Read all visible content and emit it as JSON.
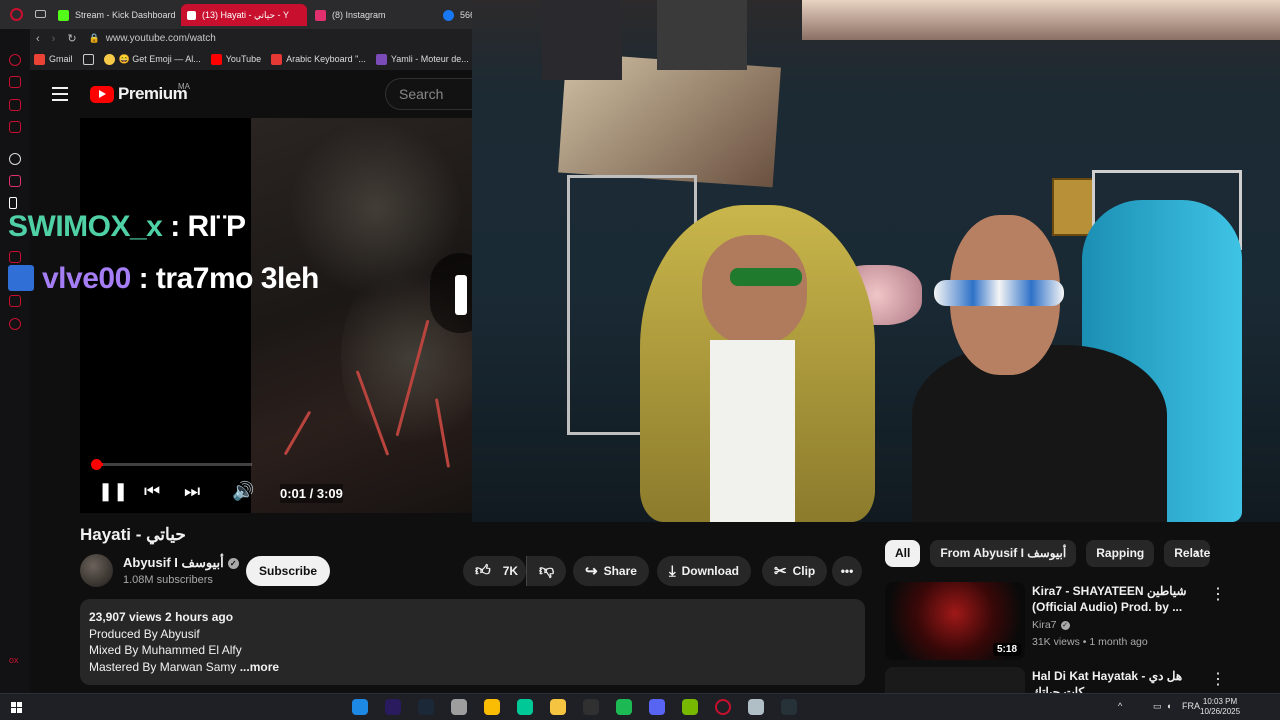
{
  "browser": {
    "tabs": [
      {
        "label": "Stream - Kick Dashboard",
        "color": "#53fc18",
        "active": false
      },
      {
        "label": "(13) Hayati - حياتي - Y",
        "color": "#ff0000",
        "active": true
      },
      {
        "label": "(8) Instagram",
        "color": "#e1306c",
        "active": false
      },
      {
        "label": "566",
        "color": "#1877f2",
        "active": false
      }
    ],
    "url": "www.youtube.com/watch",
    "bookmarks": [
      {
        "label": "Gmail",
        "color": "#ea4335"
      },
      {
        "label": "",
        "color": "#cccccc"
      },
      {
        "label": "😄 Get Emoji — Al...",
        "color": "#f7c948"
      },
      {
        "label": "YouTube",
        "color": "#ff0000"
      },
      {
        "label": "Arabic Keyboard \"...",
        "color": "#e53935"
      },
      {
        "label": "Yamli - Moteur de...",
        "color": "#7b4bb7"
      }
    ]
  },
  "header": {
    "logo_text": "Premium",
    "region": "MA",
    "search_placeholder": "Search"
  },
  "player": {
    "chat": [
      {
        "user": "SWIMOX_x",
        "message": " : RI¨P"
      },
      {
        "user": "vlve00",
        "message": " : tra7mo 3leh"
      }
    ],
    "time_current": "0:01",
    "time_total": "3:09",
    "time_display": "0:01 / 3:09",
    "progress_fraction": 0.005
  },
  "video": {
    "title": "Hayati - حياتي",
    "channel": "Abyusif I أبيوسف",
    "subscribers": "1.08M subscribers",
    "subscribe_label": "Subscribe",
    "likes": "7K",
    "share_label": "Share",
    "download_label": "Download",
    "clip_label": "Clip",
    "description": {
      "views_line": "23,907 views  2 hours ago",
      "line1": "Produced By Abyusif",
      "line2": "Mixed By Muhammed El Alfy",
      "line3": "Mastered By Marwan Samy ",
      "more": "...more"
    }
  },
  "chips": [
    "All",
    "From Abyusif I أبيوسف",
    "Rapping",
    "Related"
  ],
  "recommended": [
    {
      "title": "Kira7 - SHAYATEEN شياطين (Official Audio) Prod. by ...",
      "channel": "Kira7",
      "meta": "31K views • 1 month ago",
      "duration": "5:18"
    },
    {
      "title": "Hal Di Kat Hayatak - هل دي كات حياتك",
      "channel": "",
      "meta": "",
      "duration": ""
    }
  ],
  "taskbar": {
    "apps": [
      {
        "name": "edge",
        "color": "#1e88e5"
      },
      {
        "name": "premiere",
        "color": "#2a1a5e"
      },
      {
        "name": "steam",
        "color": "#1b2838"
      },
      {
        "name": "app",
        "color": "#9e9e9e"
      },
      {
        "name": "chrome",
        "color": "#fbbc04"
      },
      {
        "name": "app",
        "color": "#00c896"
      },
      {
        "name": "file-explorer",
        "color": "#f5c542"
      },
      {
        "name": "obs",
        "color": "#303030"
      },
      {
        "name": "spotify",
        "color": "#1db954"
      },
      {
        "name": "discord",
        "color": "#5865f2"
      },
      {
        "name": "nvidia",
        "color": "#76b900"
      },
      {
        "name": "opera",
        "color": "#c8102e"
      },
      {
        "name": "app",
        "color": "#b0bec5"
      },
      {
        "name": "app",
        "color": "#263238"
      }
    ],
    "language": "FRA",
    "time": "10:03 PM",
    "date": "10/26/2025"
  },
  "colors": {
    "background": "#0f0f0f",
    "accent": "#ff0000",
    "chip_bg": "#272727"
  }
}
